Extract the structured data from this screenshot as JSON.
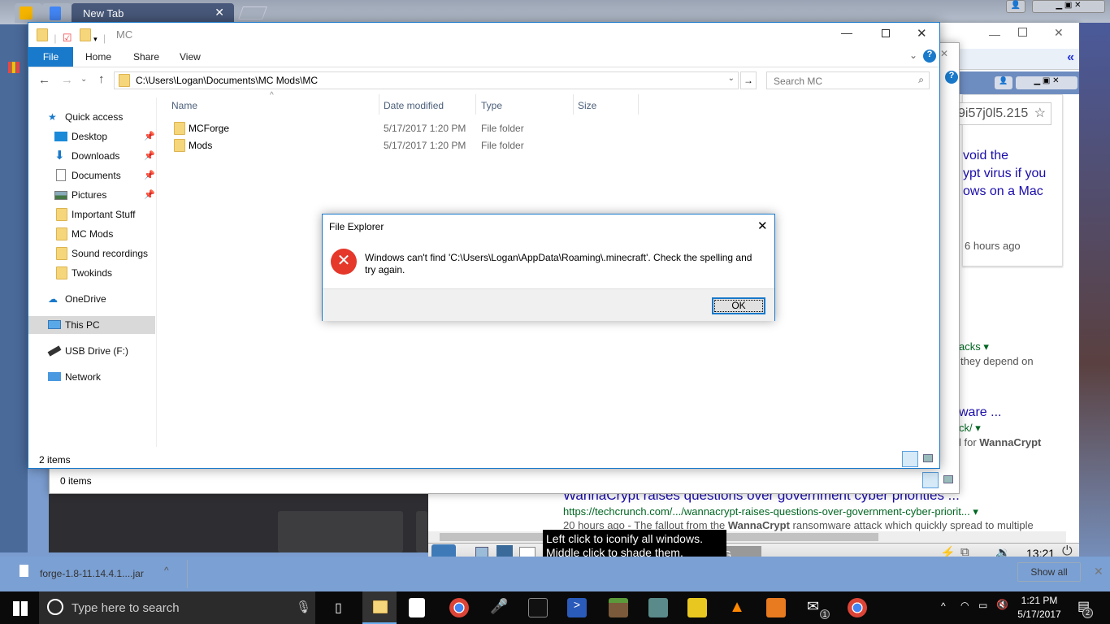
{
  "chrome_tabs": {
    "active": "New Tab"
  },
  "background_windows": {
    "url_fragment": "9i57j0l5.215",
    "win2_status": "0 items",
    "results": [
      {
        "title_frag": "void the",
        "line2": "ypt virus if you",
        "line3": "ows on a Mac",
        "time": "6 hours ago"
      },
      {
        "url_frag": "acks",
        "snippet_frag": "they depend on"
      },
      {
        "title_frag": "ware ...",
        "url_frag": "ck/",
        "snippet_frag": "l for ",
        "snippet_bold": "WannaCrypt"
      },
      {
        "title": "WannaCrypt raises questions over government cyber priorities ...",
        "url": "https://techcrunch.com/.../wannacrypt-raises-questions-over-government-cyber-priorit...",
        "snippet_pre": "20 hours ago - The fallout from the ",
        "snippet_bold": "WannaCrypt",
        "snippet_post": " ransomware attack which quickly spread to multiple"
      }
    ]
  },
  "explorer": {
    "title": "MC",
    "ribbon_tabs": [
      "File",
      "Home",
      "Share",
      "View"
    ],
    "address": "C:\\Users\\Logan\\Documents\\MC Mods\\MC",
    "search_placeholder": "Search MC",
    "columns": [
      "Name",
      "Date modified",
      "Type",
      "Size"
    ],
    "files": [
      {
        "name": "MCForge",
        "date": "5/17/2017 1:20 PM",
        "type": "File folder"
      },
      {
        "name": "Mods",
        "date": "5/17/2017 1:20 PM",
        "type": "File folder"
      }
    ],
    "nav": {
      "quick_access": "Quick access",
      "pinned": [
        "Desktop",
        "Downloads",
        "Documents",
        "Pictures"
      ],
      "folders": [
        "Important Stuff",
        "MC Mods",
        "Sound recordings",
        "Twokinds"
      ],
      "onedrive": "OneDrive",
      "this_pc": "This PC",
      "usb": "USB Drive (F:)",
      "network": "Network"
    },
    "status": "2 items"
  },
  "dialog": {
    "title": "File Explorer",
    "message": "Windows can't find 'C:\\Users\\Logan\\AppData\\Roaming\\.minecraft'. Check the spelling and try again.",
    "ok": "OK"
  },
  "lxde": {
    "tooltip_line1": "Left click to iconify all windows.",
    "tooltip_line2": "Middle click to shade them.",
    "task_frag": "G...",
    "clock": "13:21"
  },
  "download_bar": {
    "file": "forge-1.8-11.14.4.1....jar",
    "show_all": "Show all"
  },
  "taskbar": {
    "search_placeholder": "Type here to search",
    "time": "1:21 PM",
    "date": "5/17/2017",
    "notifications": "2",
    "mail_badge": "1"
  },
  "colors": {
    "accent": "#1979ca",
    "error": "#e81123",
    "link": "#1a0dab",
    "url": "#006621"
  }
}
